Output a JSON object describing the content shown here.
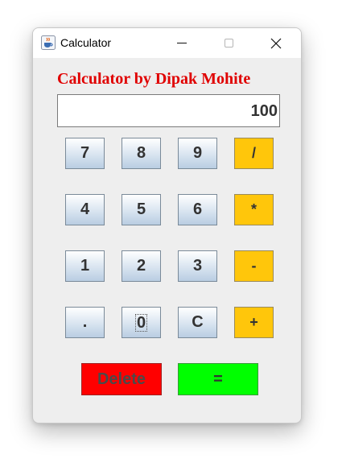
{
  "window": {
    "title": "Calculator"
  },
  "heading": "Calculator by Dipak Mohite",
  "display": {
    "value": "100"
  },
  "keys": {
    "k7": "7",
    "k8": "8",
    "k9": "9",
    "div": "/",
    "k4": "4",
    "k5": "5",
    "k6": "6",
    "mul": "*",
    "k1": "1",
    "k2": "2",
    "k3": "3",
    "sub": "-",
    "dot": ".",
    "k0": "0",
    "clear": "C",
    "add": "+"
  },
  "actions": {
    "delete": "Delete",
    "equals": "="
  },
  "colors": {
    "heading": "#e00000",
    "operator": "#ffc60b",
    "delete": "#ff0000",
    "equals": "#00ff00"
  },
  "icons": {
    "app": "java-cup-icon",
    "minimize": "minimize-icon",
    "maximize": "maximize-icon",
    "close": "close-icon"
  }
}
